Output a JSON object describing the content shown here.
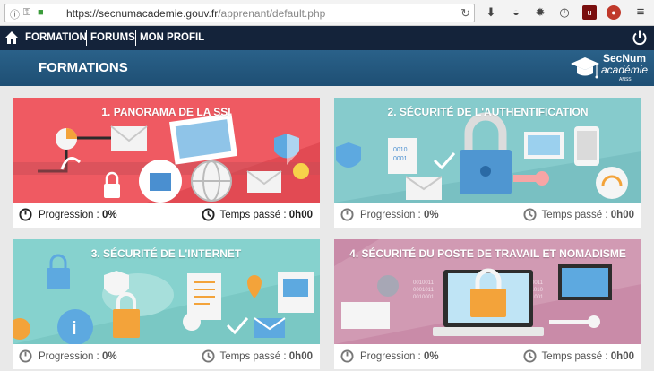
{
  "browser": {
    "url_host": "https://secnumacademie.gouv.fr",
    "url_path": "/apprenant/default.php",
    "toolbar_icons": [
      "download-icon",
      "mask-icon",
      "gear-icon",
      "clock-icon",
      "ublock-icon",
      "addon-icon",
      "menu-icon"
    ]
  },
  "nav": {
    "items": [
      "FORMATION",
      "FORUMS",
      "MON PROFIL"
    ]
  },
  "header": {
    "title": "FORMATIONS",
    "logo_line1": "SecNum",
    "logo_line2": "académie",
    "logo_line3": "ANSSI"
  },
  "labels": {
    "progress": "Progression : ",
    "time": "Temps passé : "
  },
  "colors": {
    "nav_bg": "#14233a",
    "header_bg": "#245a82",
    "card1": "#ef5a62",
    "card2": "#86cbcc",
    "card3": "#86d2ce",
    "card4": "#d19ab3"
  },
  "modules": [
    {
      "title": "1. PANORAMA DE LA SSI",
      "progress": "0%",
      "time": "0h00"
    },
    {
      "title": "2. SÉCURITÉ DE L'AUTHENTIFICATION",
      "progress": "0%",
      "time": "0h00"
    },
    {
      "title": "3. SÉCURITÉ DE L'INTERNET",
      "progress": "0%",
      "time": "0h00"
    },
    {
      "title": "4. SÉCURITÉ DU POSTE DE TRAVAIL ET NOMADISME",
      "progress": "0%",
      "time": "0h00"
    }
  ]
}
